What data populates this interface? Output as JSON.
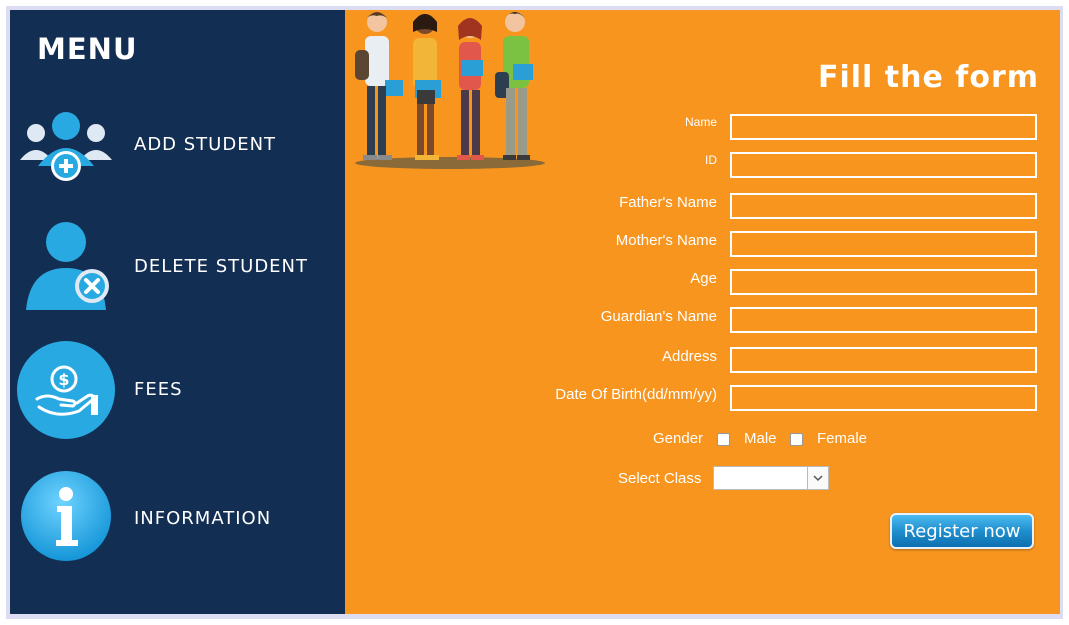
{
  "sidebar": {
    "title": "MENU",
    "items": [
      {
        "label": "ADD STUDENT",
        "icon": "add-users-icon"
      },
      {
        "label": "DELETE STUDENT",
        "icon": "delete-user-icon"
      },
      {
        "label": "FEES",
        "icon": "fees-hand-coin-icon"
      },
      {
        "label": "INFORMATION",
        "icon": "information-icon"
      }
    ]
  },
  "form": {
    "title": "Fill the form",
    "fields": [
      {
        "label": "Name",
        "value": ""
      },
      {
        "label": "ID",
        "value": ""
      },
      {
        "label": "Father's Name",
        "value": ""
      },
      {
        "label": "Mother's Name",
        "value": ""
      },
      {
        "label": "Age",
        "value": ""
      },
      {
        "label": "Guardian's Name",
        "value": ""
      },
      {
        "label": "Address",
        "value": ""
      },
      {
        "label": "Date Of Birth(dd/mm/yy)",
        "value": ""
      }
    ],
    "gender": {
      "label": "Gender",
      "options": [
        "Male",
        "Female"
      ]
    },
    "class_select": {
      "label": "Select Class",
      "value": ""
    },
    "register_label": "Register now"
  },
  "colors": {
    "sidebar": "#132e53",
    "main": "#f7951f",
    "icon_blue": "#29a9e1",
    "button_blue": "#1f8fcf"
  }
}
